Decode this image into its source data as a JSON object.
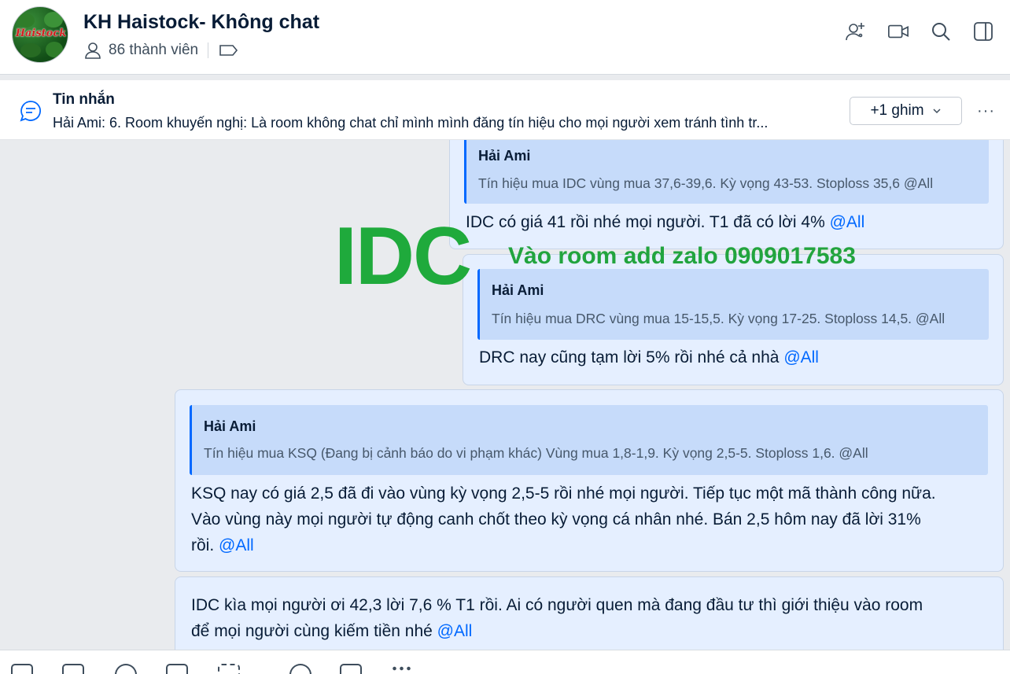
{
  "header": {
    "avatar_logo": "Haistock",
    "title": "KH Haistock- Không chat",
    "members": "86 thành viên",
    "icons": [
      "add-member-icon",
      "video-call-icon",
      "search-icon",
      "sidebar-toggle-icon"
    ]
  },
  "pinned": {
    "title": "Tin nhắn",
    "text": "Hải Ami: 6. Room khuyến nghị: Là room không chat chỉ mình mình đăng tín hiệu cho mọi người xem tránh tình tr...",
    "ghim_label": "+1 ghim",
    "more_label": "···"
  },
  "messages": [
    {
      "quote_name": "Hải Ami",
      "quote_text": "Tín hiệu mua IDC vùng mua 37,6-39,6. Kỳ vọng 43-53. Stoploss 35,6 @All",
      "text": "IDC có giá 41 rồi nhé mọi người. T1 đã có lời 4%",
      "mention": "@All"
    },
    {
      "quote_name": "Hải Ami",
      "quote_text": "Tín hiệu mua DRC vùng mua 15-15,5. Kỳ vọng 17-25. Stoploss 14,5. @All",
      "text": "DRC nay cũng tạm lời 5% rồi nhé cả nhà",
      "mention": "@All"
    },
    {
      "quote_name": "Hải Ami",
      "quote_text": "Tín hiệu mua KSQ (Đang bị cảnh báo do vi phạm khác) Vùng mua 1,8-1,9. Kỳ vọng 2,5-5. Stoploss 1,6. @All",
      "line1": "KSQ nay có giá 2,5 đã đi vào vùng kỳ vọng 2,5-5 rồi nhé mọi người. Tiếp tục một mã thành công nữa.",
      "line2": "Vào vùng này mọi người tự động canh chốt theo kỳ vọng cá nhân nhé. Bán 2,5 hôm nay đã lời 31%",
      "line3": "rồi.",
      "mention": "@All"
    },
    {
      "line1": "IDC kìa mọi người ơi 42,3 lời 7,6 % T1 rồi. Ai có người quen mà đang đầu tư thì giới thiệu vào room",
      "line2": "để mọi người cùng kiếm tiền nhé",
      "mention": "@All"
    }
  ],
  "watermark": {
    "big": "IDC",
    "small": "Vào room add zalo 0909017583"
  }
}
